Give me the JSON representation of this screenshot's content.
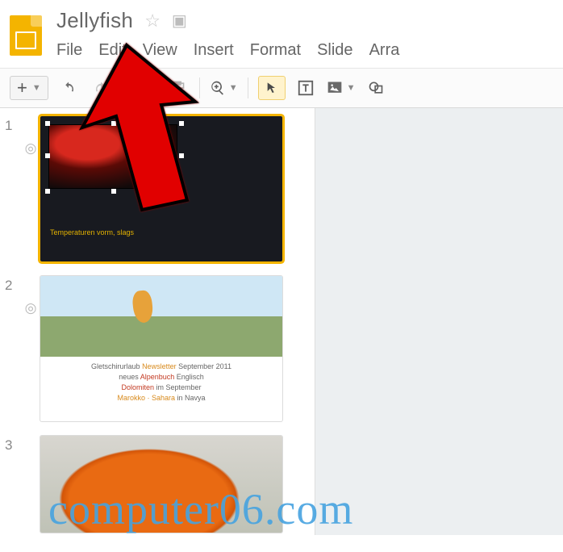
{
  "header": {
    "doc_title": "Jellyfish"
  },
  "menubar": {
    "file": "File",
    "edit": "Edit",
    "view": "View",
    "insert": "Insert",
    "format": "Format",
    "slide": "Slide",
    "arrange": "Arra"
  },
  "toolbar": {
    "new_slide_tip": "+"
  },
  "sidebar": {
    "slides": [
      {
        "num": "1",
        "caption": "Temperaturen vorm, slags"
      },
      {
        "num": "2",
        "line1_a": "Gletschirurlaub ",
        "line1_b": "Newsletter ",
        "line1_c": "September 2011",
        "line2_a": "neues ",
        "line2_b": "Alpenbuch ",
        "line2_c": "Englisch",
        "line3_a": "Dolomiten ",
        "line3_b": "im September",
        "line4_a": "Marokko · Sahara ",
        "line4_b": "in Navya"
      },
      {
        "num": "3"
      }
    ]
  },
  "watermark": "computer06.com"
}
